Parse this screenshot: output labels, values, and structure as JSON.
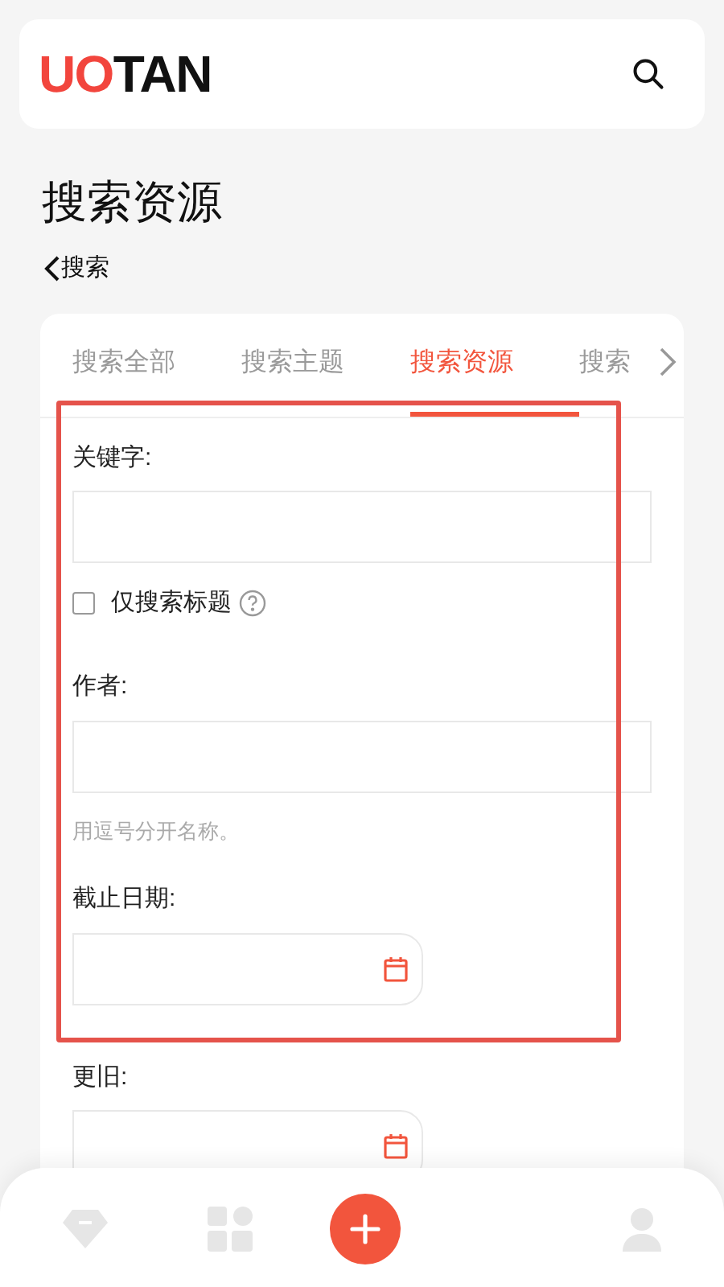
{
  "header": {
    "logo": [
      {
        "text": "UO",
        "color": "#f2453d"
      },
      {
        "text": "TAN",
        "color": "#111111"
      }
    ]
  },
  "page_title": "搜索资源",
  "back_link": "搜索",
  "tabs": [
    {
      "label": "搜索全部",
      "selected": false
    },
    {
      "label": "搜索主题",
      "selected": false
    },
    {
      "label": "搜索资源",
      "selected": true
    },
    {
      "label": "搜索",
      "selected": false
    }
  ],
  "form": [
    {
      "kind": "text",
      "label": "关键字:"
    },
    {
      "kind": "checkbox",
      "label": "仅搜索标题",
      "checked": false
    },
    {
      "kind": "text",
      "label": "作者:",
      "hint": "用逗号分开名称。"
    },
    {
      "kind": "date",
      "label": "截止日期:"
    },
    {
      "kind": "date",
      "label": "更旧:"
    }
  ],
  "bottom_nav": [
    {
      "kind": "diamond"
    },
    {
      "kind": "grid"
    },
    {
      "kind": "add"
    },
    {
      "kind": "person"
    }
  ]
}
